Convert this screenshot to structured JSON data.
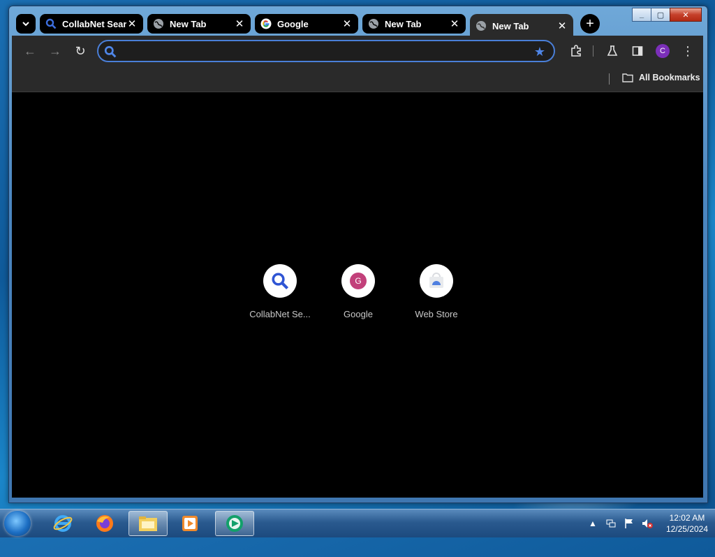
{
  "browser": {
    "tabs": [
      {
        "title": "CollabNet Sear",
        "favicon": "search-icon",
        "active": false
      },
      {
        "title": "New Tab",
        "favicon": "globe-icon",
        "active": false
      },
      {
        "title": "Google",
        "favicon": "google-icon",
        "active": false
      },
      {
        "title": "New Tab",
        "favicon": "globe-icon",
        "active": false
      },
      {
        "title": "New Tab",
        "favicon": "globe-icon",
        "active": true
      }
    ],
    "omnibox": {
      "value": "",
      "placeholder": ""
    },
    "bookmarks": {
      "all_label": "All Bookmarks"
    },
    "profile_initial": "C",
    "accent": "#4f86e8"
  },
  "shortcuts": [
    {
      "label": "CollabNet Se...",
      "icon": "search-icon"
    },
    {
      "label": "Google",
      "icon": "google-avatar-icon",
      "letter": "G"
    },
    {
      "label": "Web Store",
      "icon": "webstore-icon"
    }
  ],
  "taskbar": {
    "apps": [
      "internet-explorer-icon",
      "firefox-icon",
      "file-explorer-icon",
      "media-player-icon",
      "browser-app-icon"
    ],
    "clock": {
      "time": "12:02 AM",
      "date": "12/25/2024"
    }
  }
}
